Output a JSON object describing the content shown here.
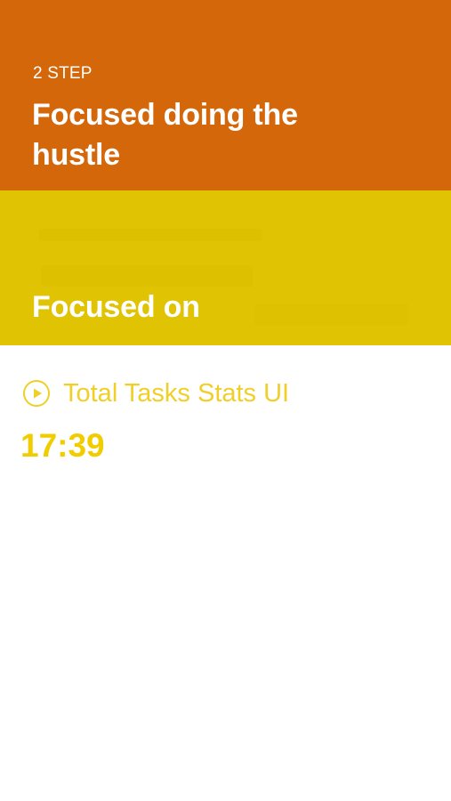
{
  "header": {
    "step_label": "2 STEP",
    "title": "Focused doing the hustle"
  },
  "focus_panel": {
    "title": "Focused on"
  },
  "task": {
    "icon": "play-circle-icon",
    "name": "Total Tasks Stats UI",
    "time": "17:39"
  },
  "colors": {
    "header_background": "#d5670b",
    "focus_background": "#e0c403",
    "accent": "#f0cf29"
  }
}
